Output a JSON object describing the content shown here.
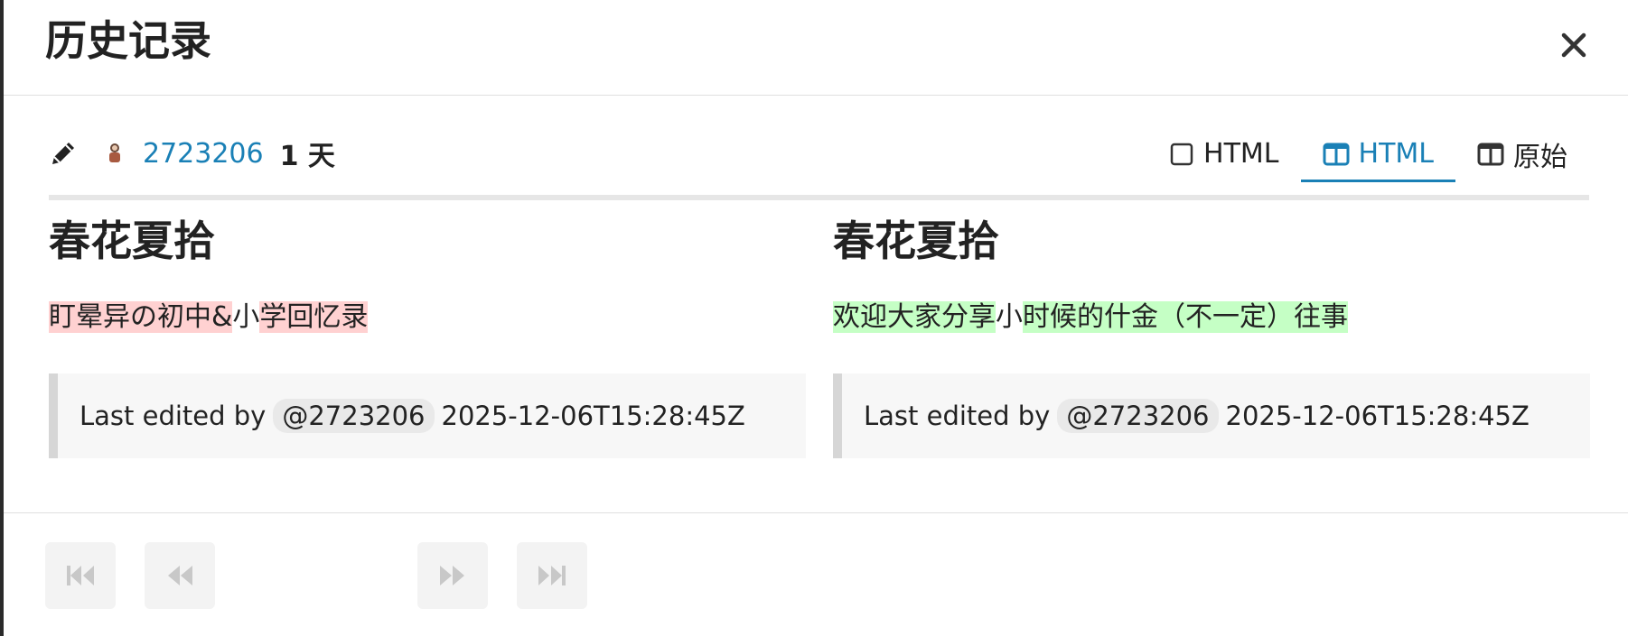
{
  "modal": {
    "title": "历史记录"
  },
  "revision": {
    "username": "2723206",
    "age": "1 天"
  },
  "tabs": [
    {
      "label": "HTML",
      "icon": "square-icon",
      "active": false
    },
    {
      "label": "HTML",
      "icon": "side-by-side-icon",
      "active": true
    },
    {
      "label": "原始",
      "icon": "side-by-side-icon",
      "active": false
    }
  ],
  "left": {
    "title": "春花夏拾",
    "segments": [
      {
        "text": "盯晕异の初中&",
        "type": "del"
      },
      {
        "text": "小",
        "type": "same"
      },
      {
        "text": "学回忆录",
        "type": "del"
      }
    ],
    "quote": {
      "prefix": "Last edited by",
      "mention": "@2723206",
      "timestamp": "2025-12-06T15:28:45Z"
    }
  },
  "right": {
    "title": "春花夏拾",
    "segments": [
      {
        "text": "欢迎大家分享",
        "type": "ins"
      },
      {
        "text": "小",
        "type": "same"
      },
      {
        "text": "时候的什金（不一定）往事",
        "type": "ins"
      }
    ],
    "quote": {
      "prefix": "Last edited by",
      "mention": "@2723206",
      "timestamp": "2025-12-06T15:28:45Z"
    }
  },
  "colors": {
    "accent": "#1a80b6",
    "deleted_bg": "#ffd1d1",
    "inserted_bg": "#c5ffc5"
  },
  "nav": {
    "first": "first-icon",
    "prev": "rewind-icon",
    "next": "fast-forward-icon",
    "last": "last-icon"
  }
}
